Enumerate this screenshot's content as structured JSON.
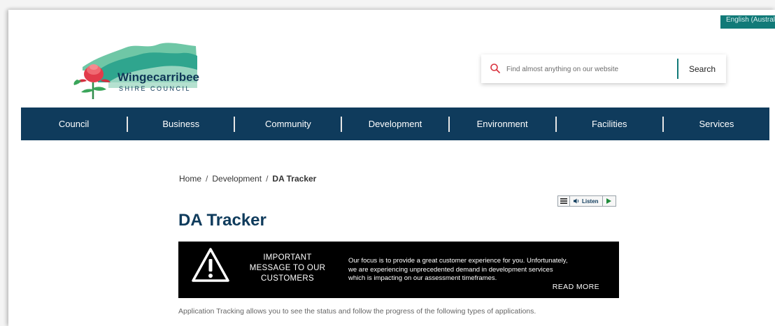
{
  "header": {
    "language_label": "English (Australia)",
    "logo": {
      "name_line1": "Wingecarribee",
      "name_line2": "SHIRE COUNCIL"
    },
    "search": {
      "placeholder": "Find almost anything on our website",
      "button_label": "Search"
    }
  },
  "nav": {
    "items": [
      {
        "label": "Council"
      },
      {
        "label": "Business"
      },
      {
        "label": "Community"
      },
      {
        "label": "Development"
      },
      {
        "label": "Environment"
      },
      {
        "label": "Facilities"
      },
      {
        "label": "Services"
      }
    ]
  },
  "breadcrumb": {
    "items": [
      "Home",
      "Development",
      "DA Tracker"
    ],
    "separator": "/"
  },
  "listen": {
    "label": "Listen"
  },
  "page": {
    "title": "DA Tracker",
    "banner": {
      "heading_lines": [
        "IMPORTANT",
        "MESSAGE TO OUR",
        "CUSTOMERS"
      ],
      "body_lines": [
        "Our focus is to provide a great customer experience for you. Unfortunately,",
        "we are experiencing unprecedented demand in development services",
        "which is impacting on our assessment timeframes."
      ],
      "read_more": "READ MORE"
    },
    "intro": "Application Tracking allows you to see the status and follow the progress of the following types of applications."
  },
  "colors": {
    "nav_bg": "#0f3b5c",
    "accent_teal": "#117a78",
    "title": "#0f3b5c",
    "banner_bg": "#000000"
  }
}
